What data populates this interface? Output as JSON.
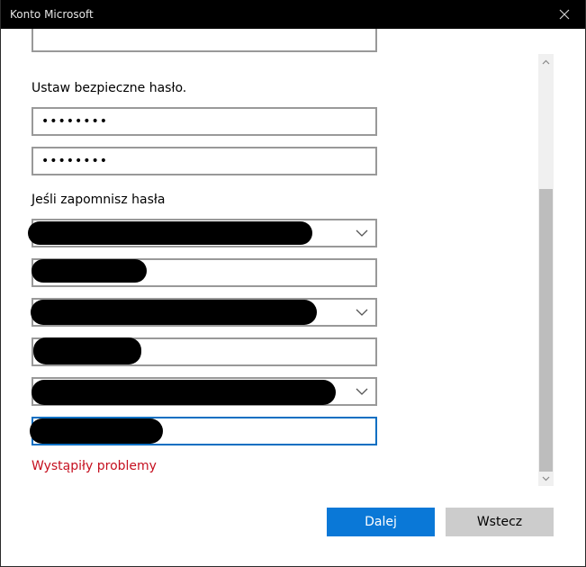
{
  "window": {
    "title": "Konto Microsoft"
  },
  "form": {
    "password_heading": "Ustaw bezpieczne hasło.",
    "password_value": "••••••••",
    "confirm_password_value": "••••••••",
    "recovery_heading": "Jeśli zapomnisz hasła",
    "error_message": "Wystąpiły problemy"
  },
  "buttons": {
    "next_label": "Dalej",
    "back_label": "Wstecz"
  },
  "colors": {
    "titlebar": "#000000",
    "primary_button": "#0a78d7",
    "secondary_button": "#cccccc",
    "error_text": "#c50f1f",
    "focus_border": "#0a6fc2"
  },
  "icons": {
    "close": "close-icon",
    "dropdown": "chevron-down-icon",
    "scroll_up": "scroll-up-arrow-icon",
    "scroll_down": "scroll-down-arrow-icon"
  }
}
